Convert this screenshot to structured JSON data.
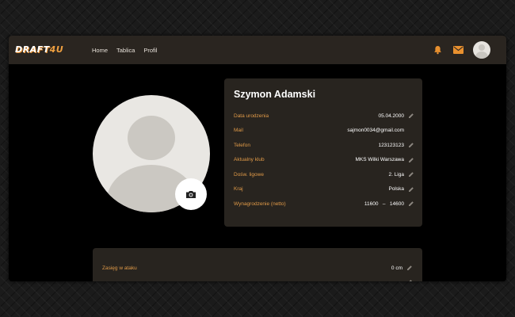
{
  "brand": {
    "logo_main": "DRAFT",
    "logo_accent": "4U"
  },
  "nav": {
    "links": [
      {
        "label": "Home"
      },
      {
        "label": "Tablica"
      },
      {
        "label": "Profil"
      }
    ],
    "icons": [
      "bell-icon",
      "mail-icon",
      "avatar"
    ]
  },
  "colors": {
    "accent": "#e8902f",
    "label": "#e09a48",
    "card_bg": "#28241f",
    "navbar_bg": "#2a2520",
    "page_bg": "#000000"
  },
  "profile": {
    "name": "Szymon Adamski",
    "fields": [
      {
        "label": "Data urodzenia",
        "value": "05.04.2000",
        "editable": true
      },
      {
        "label": "Mail",
        "value": "sajmon0034@gmail.com",
        "editable": false
      },
      {
        "label": "Telefon",
        "value": "123123123",
        "editable": true
      },
      {
        "label": "Aktualny klub",
        "value": "MKS Wilki Warszawa",
        "editable": true
      },
      {
        "label": "Dośw. ligowe",
        "value": "2. Liga",
        "editable": true
      },
      {
        "label": "Kraj",
        "value": "Polska",
        "editable": true
      },
      {
        "label": "Wynagrodzenie (netto)",
        "value": "11600   –   14600",
        "editable": true
      }
    ]
  },
  "stats": {
    "fields": [
      {
        "label": "Zasięg w ataku",
        "value": "0 cm",
        "editable": true
      }
    ]
  }
}
